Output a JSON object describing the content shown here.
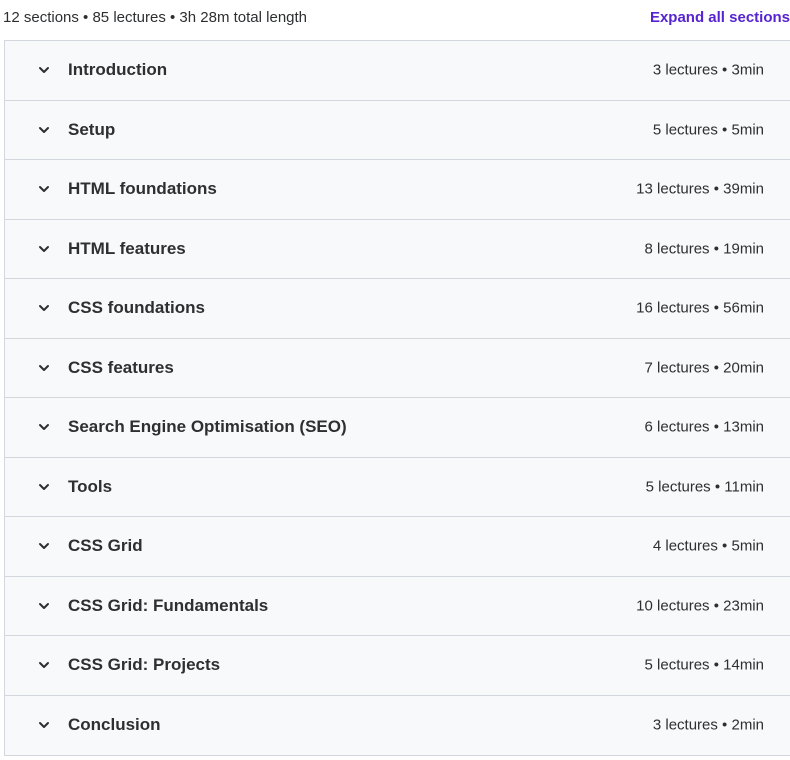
{
  "summary": {
    "text": "12 sections • 85 lectures • 3h 28m total length",
    "expand_label": "Expand all sections"
  },
  "sections": [
    {
      "title": "Introduction",
      "meta": "3 lectures • 3min",
      "icon": "chevron-down-icon"
    },
    {
      "title": "Setup",
      "meta": "5 lectures • 5min",
      "icon": "chevron-down-icon"
    },
    {
      "title": "HTML foundations",
      "meta": "13 lectures • 39min",
      "icon": "chevron-down-icon"
    },
    {
      "title": "HTML features",
      "meta": "8 lectures • 19min",
      "icon": "chevron-down-icon"
    },
    {
      "title": "CSS foundations",
      "meta": "16 lectures • 56min",
      "icon": "chevron-down-icon"
    },
    {
      "title": "CSS features",
      "meta": "7 lectures • 20min",
      "icon": "chevron-down-icon"
    },
    {
      "title": "Search Engine Optimisation (SEO)",
      "meta": "6 lectures • 13min",
      "icon": "chevron-down-icon"
    },
    {
      "title": "Tools",
      "meta": "5 lectures • 11min",
      "icon": "chevron-down-icon"
    },
    {
      "title": "CSS Grid",
      "meta": "4 lectures • 5min",
      "icon": "chevron-down-icon"
    },
    {
      "title": "CSS Grid: Fundamentals",
      "meta": "10 lectures • 23min",
      "icon": "chevron-down-icon"
    },
    {
      "title": "CSS Grid: Projects",
      "meta": "5 lectures • 14min",
      "icon": "chevron-down-icon"
    },
    {
      "title": "Conclusion",
      "meta": "3 lectures • 2min",
      "icon": "chevron-down-icon"
    }
  ],
  "colors": {
    "accent": "#5624d0",
    "row_background": "#f7f9fa",
    "border": "#d1d7dc",
    "text": "#2d2f31"
  }
}
